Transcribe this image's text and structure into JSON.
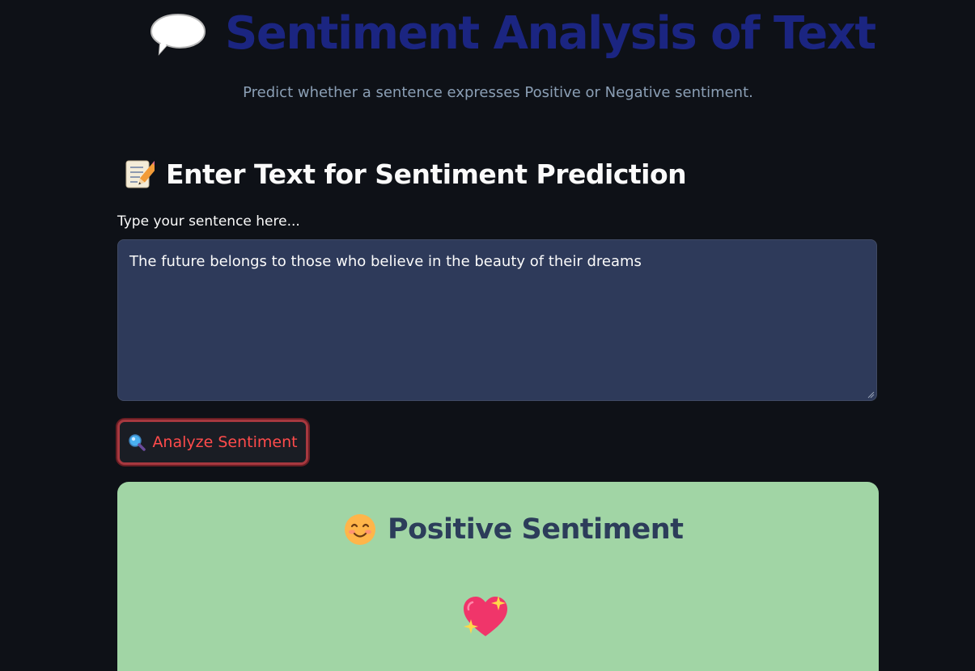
{
  "header": {
    "title": "Sentiment Analysis of Text",
    "subtitle": "Predict whether a sentence expresses Positive or Negative sentiment.",
    "title_icon": "speech-balloon-icon"
  },
  "input_section": {
    "heading": "Enter Text for Sentiment Prediction",
    "heading_icon": "memo-icon",
    "label": "Type your sentence here...",
    "value": "The future belongs to those who believe in the beauty of their dreams"
  },
  "analyze_button": {
    "label": "Analyze Sentiment",
    "icon": "magnifying-glass-icon"
  },
  "result": {
    "title": "Positive Sentiment",
    "title_icon": "smiling-face-icon",
    "decor_icon": "sparkling-heart-icon"
  },
  "colors": {
    "background": "#0e1117",
    "title": "#1b2581",
    "subtitle": "#8b9fb5",
    "textarea": "#2e3a5a",
    "button_text": "#ff4b4b",
    "button_border": "#a7383f",
    "result_bg": "#a1d5a5",
    "result_text": "#2c3d5a"
  }
}
